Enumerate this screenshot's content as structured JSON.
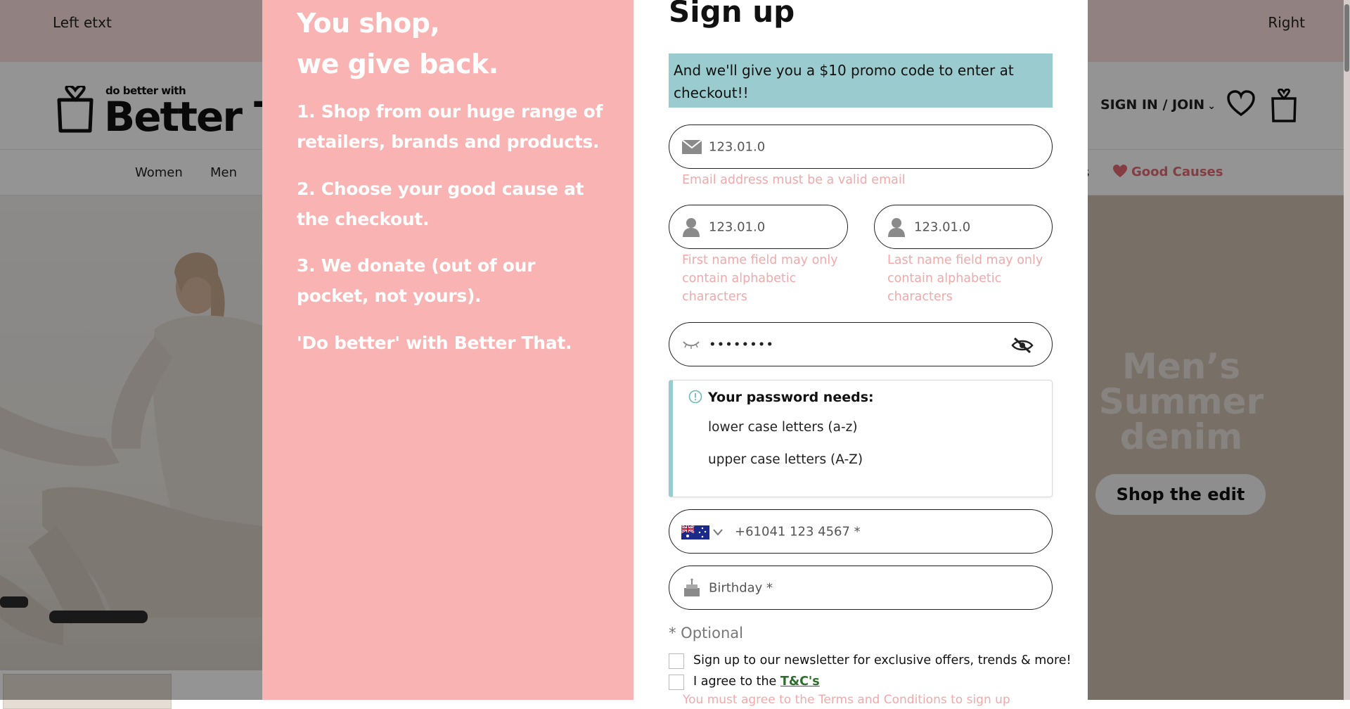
{
  "topbar": {
    "left_text": "Left etxt",
    "right_text": "Right"
  },
  "header": {
    "logo_tagline": "do better with",
    "logo_name": "Better Th",
    "signin": "SIGN IN / JOIN",
    "signin_chevron": "⌄"
  },
  "nav": {
    "items": [
      "Women",
      "Men",
      "s"
    ],
    "good_causes": "Good Causes"
  },
  "hero": {
    "promo": "Men’s Summer denim",
    "cta": "Shop the edit"
  },
  "modal": {
    "left": {
      "headline_1": "You shop,",
      "headline_2": "we give back.",
      "steps": [
        "1. Shop from our huge range of retailers, brands and products.",
        "2. Choose your good cause at the checkout.",
        "3. We donate (out of our pocket, not yours).",
        "'Do better' with Better That."
      ]
    },
    "title": "Sign up",
    "promo_note": "And we'll give you a $10 promo code to enter at checkout!!",
    "email": {
      "value": "123.01.0",
      "error": "Email address must be a valid email"
    },
    "first_name": {
      "value": "123.01.0",
      "error": "First name field may only contain alphabetic characters"
    },
    "last_name": {
      "value": "123.01.0",
      "error": "Last name field may only contain alphabetic characters"
    },
    "password": {
      "value": "••••••••"
    },
    "password_rules": {
      "heading": "Your password needs:",
      "items": [
        "lower case letters (a-z)",
        "upper case letters (A-Z)"
      ]
    },
    "phone": {
      "country_code": "+61",
      "placeholder": "041 123 4567 *"
    },
    "birthday": {
      "placeholder": "Birthday *"
    },
    "optional_note": "* Optional",
    "newsletter_label": "Sign up to our newsletter for exclusive offers, trends & more!",
    "terms_prefix": "I agree to the ",
    "terms_link": "T&C's",
    "terms_error_partial": "You must agree to the Terms and Conditions to sign up"
  },
  "colors": {
    "modal_left_bg": "#f8b3b2",
    "promo_bg": "#9acbce",
    "error": "#f2a9a9"
  }
}
